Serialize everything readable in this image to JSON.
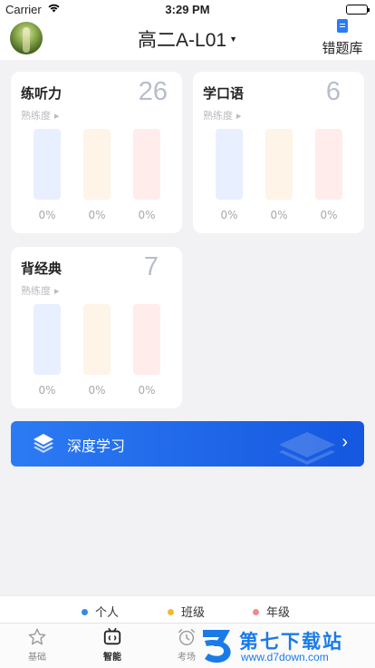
{
  "status_bar": {
    "carrier": "Carrier",
    "time": "3:29 PM"
  },
  "header": {
    "class_name": "高二A-L01",
    "mistakes_label": "错题库"
  },
  "cards": [
    {
      "title": "练听力",
      "count": "26",
      "proficiency_label": "熟练度",
      "bars": [
        {
          "percent": "0%",
          "value": 0
        },
        {
          "percent": "0%",
          "value": 0
        },
        {
          "percent": "0%",
          "value": 0
        }
      ]
    },
    {
      "title": "学口语",
      "count": "6",
      "proficiency_label": "熟练度",
      "bars": [
        {
          "percent": "0%",
          "value": 0
        },
        {
          "percent": "0%",
          "value": 0
        },
        {
          "percent": "0%",
          "value": 0
        }
      ]
    },
    {
      "title": "背经典",
      "count": "7",
      "proficiency_label": "熟练度",
      "bars": [
        {
          "percent": "0%",
          "value": 0
        },
        {
          "percent": "0%",
          "value": 0
        },
        {
          "percent": "0%",
          "value": 0
        }
      ]
    }
  ],
  "deep_learning": {
    "label": "深度学习"
  },
  "legend": [
    {
      "label": "个人",
      "color": "#2f8ce8"
    },
    {
      "label": "班级",
      "color": "#f5b82e"
    },
    {
      "label": "年级",
      "color": "#f08a8a"
    }
  ],
  "tabs": [
    {
      "label": "基础",
      "icon": "star-icon",
      "active": false
    },
    {
      "label": "智能",
      "icon": "robot-icon",
      "active": true
    },
    {
      "label": "考场",
      "icon": "alarm-clock-icon",
      "active": false
    }
  ],
  "watermark": {
    "title": "第七下载站",
    "url": "www.d7down.com"
  },
  "colors": {
    "accent": "#2c7bf3",
    "bar_blue": "#e8efff",
    "bar_orange": "#fff4e8",
    "bar_red": "#ffeceb"
  }
}
